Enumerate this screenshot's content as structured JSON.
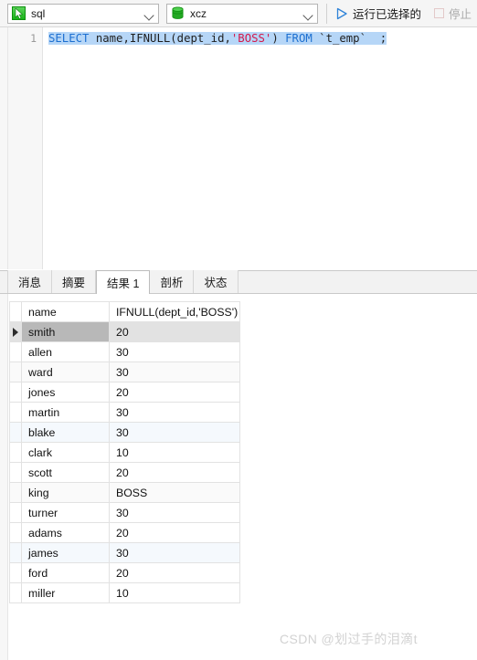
{
  "toolbar": {
    "query_select": {
      "value": "sql",
      "icon": "query-green-icon"
    },
    "database_select": {
      "value": "xcz",
      "icon": "database-cylinder-icon"
    },
    "run_button": {
      "label": "运行已选择的",
      "icon": "play-triangle-icon"
    },
    "stop_button": {
      "label": "停止",
      "icon": "stop-square-icon",
      "disabled": true
    }
  },
  "editor": {
    "line_number": "1",
    "sql_tokens": [
      {
        "t": "SELECT",
        "k": "kw"
      },
      {
        "t": " ",
        "k": "pln"
      },
      {
        "t": "name,IFNULL(dept_id,",
        "k": "pln"
      },
      {
        "t": "'BOSS'",
        "k": "str"
      },
      {
        "t": ")",
        "k": "pln"
      },
      {
        "t": " ",
        "k": "pln"
      },
      {
        "t": "FROM",
        "k": "kw"
      },
      {
        "t": " `t_emp`  ;",
        "k": "pln"
      }
    ],
    "sql_text": "SELECT name,IFNULL(dept_id,'BOSS') FROM `t_emp`  ;"
  },
  "result_tabs": [
    {
      "label": "消息",
      "active": false
    },
    {
      "label": "摘要",
      "active": false
    },
    {
      "label": "结果 1",
      "active": true
    },
    {
      "label": "剖析",
      "active": false
    },
    {
      "label": "状态",
      "active": false
    }
  ],
  "result_grid": {
    "columns": [
      "name",
      "IFNULL(dept_id,'BOSS')"
    ],
    "rows": [
      {
        "name": "smith",
        "value": "20",
        "selected": true,
        "style": "selected"
      },
      {
        "name": "allen",
        "value": "30",
        "selected": false,
        "style": "plain"
      },
      {
        "name": "ward",
        "value": "30",
        "selected": false,
        "style": "stripe"
      },
      {
        "name": "jones",
        "value": "20",
        "selected": false,
        "style": "plain"
      },
      {
        "name": "martin",
        "value": "30",
        "selected": false,
        "style": "plain"
      },
      {
        "name": "blake",
        "value": "30",
        "selected": false,
        "style": "alt"
      },
      {
        "name": "clark",
        "value": "10",
        "selected": false,
        "style": "plain"
      },
      {
        "name": "scott",
        "value": "20",
        "selected": false,
        "style": "plain"
      },
      {
        "name": "king",
        "value": "BOSS",
        "selected": false,
        "style": "stripe"
      },
      {
        "name": "turner",
        "value": "30",
        "selected": false,
        "style": "plain"
      },
      {
        "name": "adams",
        "value": "20",
        "selected": false,
        "style": "plain"
      },
      {
        "name": "james",
        "value": "30",
        "selected": false,
        "style": "alt"
      },
      {
        "name": "ford",
        "value": "20",
        "selected": false,
        "style": "plain"
      },
      {
        "name": "miller",
        "value": "10",
        "selected": false,
        "style": "plain"
      }
    ]
  },
  "watermark": {
    "text": "CSDN @划过手的泪滴t"
  },
  "colors": {
    "keyword": "#1c6fd0",
    "string": "#d4184a",
    "selection": "#b6d6f7",
    "accent_green": "#19b519",
    "play_blue": "#2f83d8",
    "row_selected": "#b8b8b8"
  }
}
